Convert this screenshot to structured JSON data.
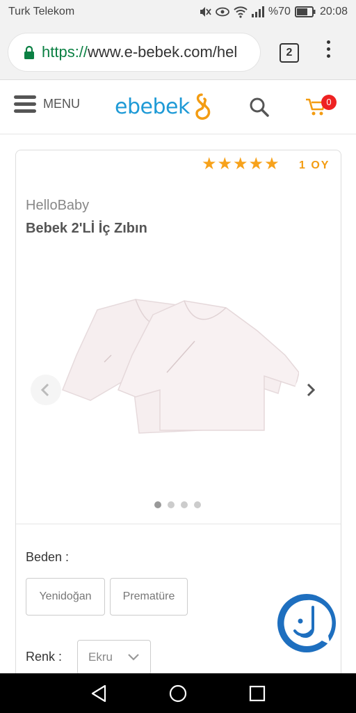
{
  "status_bar": {
    "carrier": "Turk Telekom",
    "battery": "%70",
    "time": "20:08"
  },
  "browser": {
    "url_scheme": "https://",
    "url_rest": "www.e-bebek.com/hel",
    "tab_count": "2"
  },
  "header": {
    "menu_label": "MENU",
    "logo_text": "ebebek",
    "cart_count": "0"
  },
  "product": {
    "rating_stars": 5,
    "reviews": "1  OY",
    "brand": "HelloBaby",
    "name": "Bebek 2'Lİ İç Zıbın",
    "image_count": 4,
    "active_image": 1
  },
  "options": {
    "size_label": "Beden :",
    "sizes": [
      "Yenidoğan",
      "Prematüre"
    ],
    "color_label": "Renk :",
    "color_value": "Ekru"
  },
  "colors": {
    "accent_blue": "#1e9ad6",
    "accent_orange": "#f39c12",
    "star": "#f7a21b",
    "badge_red": "#ee2222"
  }
}
